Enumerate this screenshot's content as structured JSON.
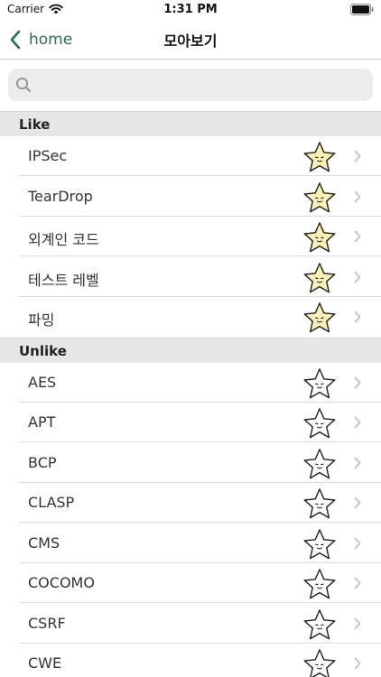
{
  "status": {
    "carrier": "Carrier",
    "time": "1:31 PM"
  },
  "nav": {
    "back_label": "home",
    "title": "모아보기"
  },
  "search": {
    "placeholder": ""
  },
  "sections": [
    {
      "title": "Like",
      "items": [
        "IPSec",
        "TearDrop",
        "외계인 코드",
        "테스트 레벨",
        "파밍"
      ]
    },
    {
      "title": "Unlike",
      "items": [
        "AES",
        "APT",
        "BCP",
        "CLASP",
        "CMS",
        "COCOMO",
        "CSRF",
        "CWE"
      ]
    }
  ],
  "colors": {
    "accent": "#2e6b5e",
    "star_fill_liked": "#fbf1b8",
    "star_fill_unliked": "#ffffff",
    "section_bg": "#e6e6e6"
  },
  "icons": {
    "back": "chevron-left-icon",
    "search": "search-icon",
    "liked": "star-liked-icon",
    "unliked": "star-unliked-icon",
    "disclosure": "chevron-right-icon"
  }
}
